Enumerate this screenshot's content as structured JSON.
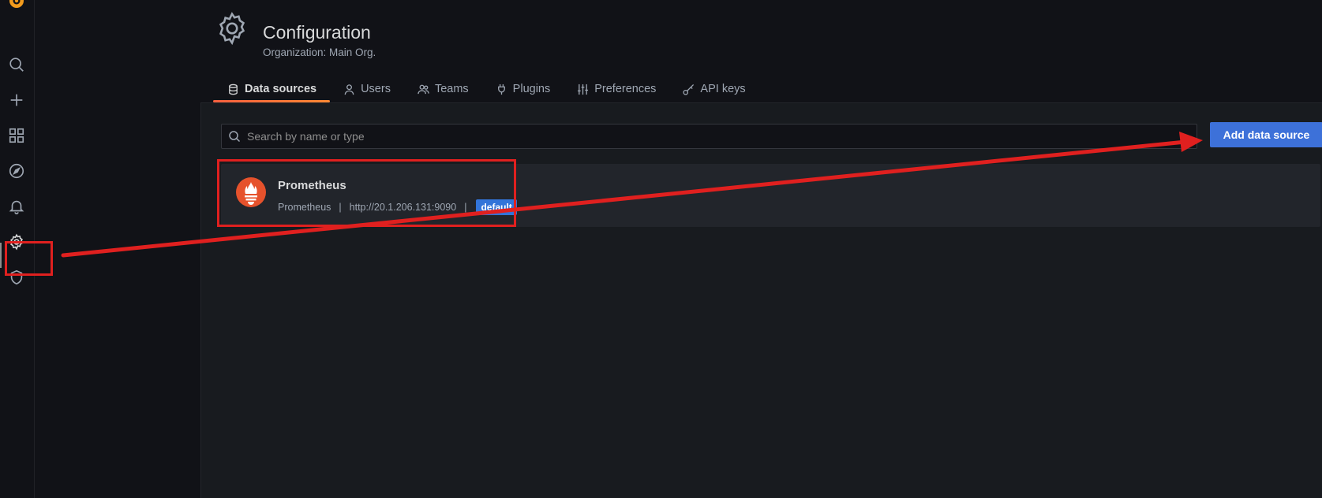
{
  "nav": {
    "items": [
      {
        "name": "search-icon"
      },
      {
        "name": "plus-icon"
      },
      {
        "name": "dashboards-icon"
      },
      {
        "name": "explore-icon"
      },
      {
        "name": "bell-icon"
      },
      {
        "name": "gear-icon",
        "active": true
      },
      {
        "name": "shield-icon"
      }
    ]
  },
  "header": {
    "title": "Configuration",
    "subtitle": "Organization: Main Org."
  },
  "tabs": [
    {
      "label": "Data sources",
      "icon": "database-icon",
      "active": true
    },
    {
      "label": "Users",
      "icon": "user-icon"
    },
    {
      "label": "Teams",
      "icon": "users-icon"
    },
    {
      "label": "Plugins",
      "icon": "plug-icon"
    },
    {
      "label": "Preferences",
      "icon": "sliders-icon"
    },
    {
      "label": "API keys",
      "icon": "key-icon"
    }
  ],
  "search": {
    "placeholder": "Search by name or type",
    "value": ""
  },
  "add_button_label": "Add data source",
  "datasources": [
    {
      "name": "Prometheus",
      "type": "Prometheus",
      "url": "http://20.1.206.131:9090",
      "badge": "default",
      "icon": "prometheus-icon"
    }
  ],
  "colors": {
    "accent": "#3d71d9",
    "tab_underline": "#f55f3e",
    "badge": "#3274d9",
    "annotation": "#e0201f",
    "prometheus": "#e6522c"
  }
}
